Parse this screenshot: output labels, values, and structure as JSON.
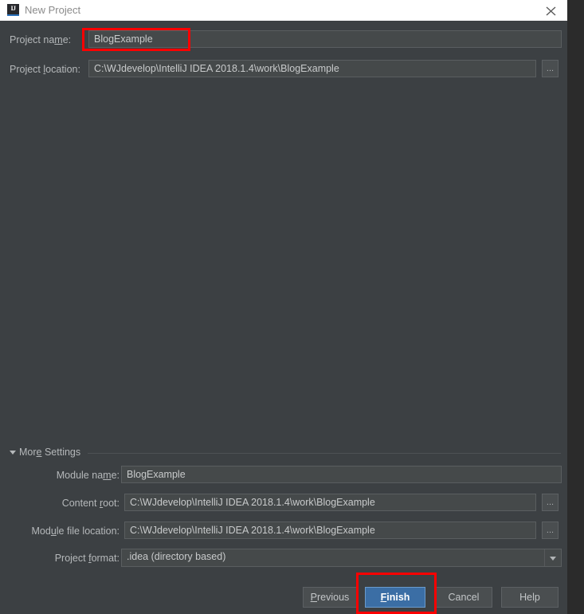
{
  "window": {
    "title": "New Project",
    "app_icon": "intellij-idea-icon",
    "close_icon": "close-icon"
  },
  "top_form": {
    "project_name": {
      "label_prefix": "Project na",
      "label_mnemonic": "m",
      "label_suffix": "e:",
      "value": "BlogExample"
    },
    "project_location": {
      "label_prefix": "Project ",
      "label_mnemonic": "l",
      "label_suffix": "ocation:",
      "value": "C:\\WJdevelop\\IntelliJ IDEA 2018.1.4\\work\\BlogExample",
      "browse_label": "..."
    }
  },
  "more_settings": {
    "label_prefix": "Mor",
    "label_mnemonic": "e",
    "label_suffix": " Settings",
    "expander_icon": "triangle-down-icon",
    "expanded": true,
    "module_name": {
      "label_prefix": "Module na",
      "label_mnemonic": "m",
      "label_suffix": "e:",
      "value": "BlogExample"
    },
    "content_root": {
      "label_prefix": "Content ",
      "label_mnemonic": "r",
      "label_suffix": "oot:",
      "value": "C:\\WJdevelop\\IntelliJ IDEA 2018.1.4\\work\\BlogExample",
      "browse_label": "..."
    },
    "module_file_location": {
      "label_prefix": "Mod",
      "label_mnemonic": "u",
      "label_suffix": "le file location:",
      "value": "C:\\WJdevelop\\IntelliJ IDEA 2018.1.4\\work\\BlogExample",
      "browse_label": "..."
    },
    "project_format": {
      "label_prefix": "Project ",
      "label_mnemonic": "f",
      "label_suffix": "ormat:",
      "value": ".idea (directory based)",
      "dropdown_icon": "chevron-down-icon"
    }
  },
  "buttons": {
    "previous": {
      "prefix": "",
      "mnemonic": "P",
      "suffix": "revious"
    },
    "finish": {
      "prefix": "",
      "mnemonic": "F",
      "suffix": "inish"
    },
    "cancel": {
      "prefix": "Cancel",
      "mnemonic": "",
      "suffix": ""
    },
    "help": {
      "prefix": "Help",
      "mnemonic": "",
      "suffix": ""
    }
  },
  "colors": {
    "dialog_background": "#3c4043",
    "desktop_background": "#2b2b2b",
    "titlebar_background": "#ffffff",
    "field_background": "#45494a",
    "primary_button": "#3b6ea5",
    "annotation": "#fe0000",
    "text": "#b5b8ba"
  },
  "annotations": [
    {
      "name": "project-name-highlight"
    },
    {
      "name": "finish-button-highlight"
    }
  ]
}
